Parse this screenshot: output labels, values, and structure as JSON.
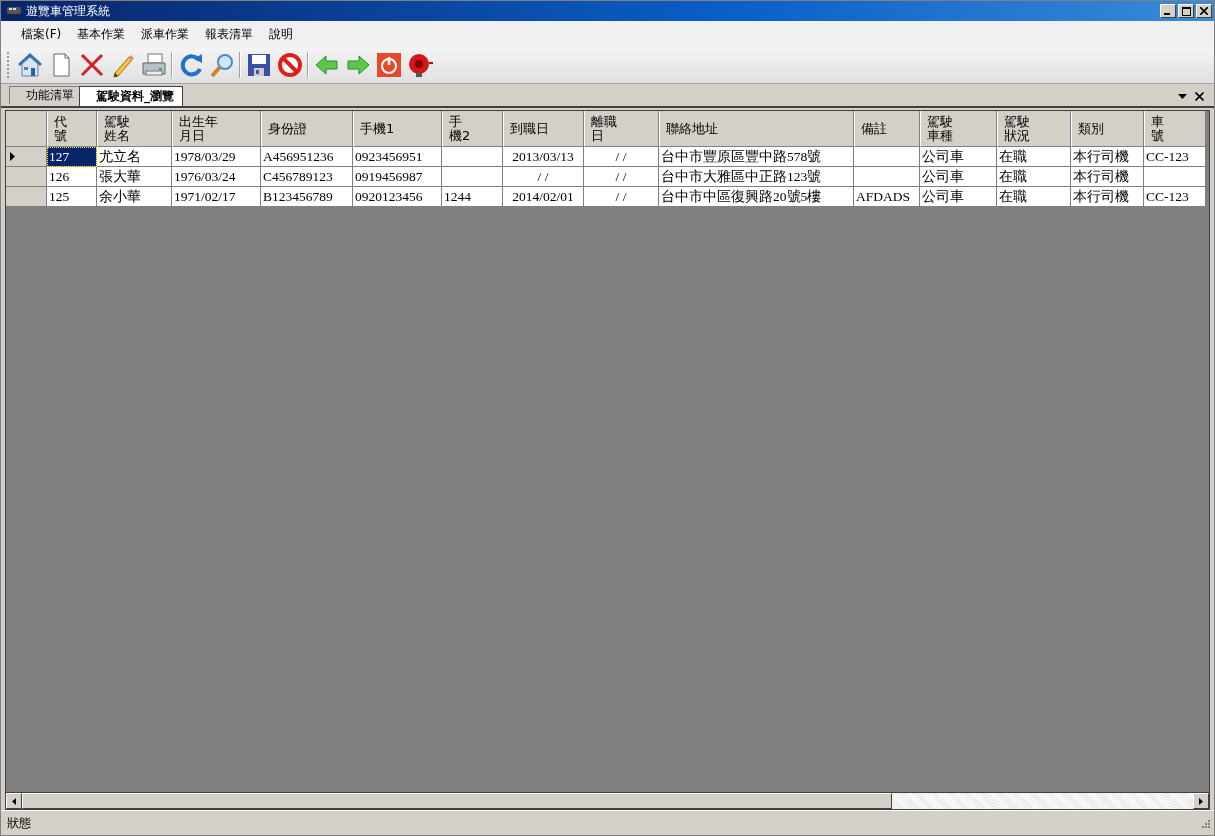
{
  "window": {
    "title": "遊覽車管理系統"
  },
  "menu": [
    {
      "label": "檔案(F)"
    },
    {
      "label": "基本作業"
    },
    {
      "label": "派車作業"
    },
    {
      "label": "報表清單"
    },
    {
      "label": "說明"
    }
  ],
  "toolbar": [
    {
      "kind": "home"
    },
    {
      "kind": "new"
    },
    {
      "kind": "delete"
    },
    {
      "kind": "edit"
    },
    {
      "kind": "print"
    },
    {
      "kind": "separator"
    },
    {
      "kind": "refresh"
    },
    {
      "kind": "search"
    },
    {
      "kind": "separator"
    },
    {
      "kind": "save"
    },
    {
      "kind": "cancel"
    },
    {
      "kind": "separator"
    },
    {
      "kind": "back"
    },
    {
      "kind": "forward"
    },
    {
      "kind": "power"
    },
    {
      "kind": "alarm"
    }
  ],
  "tabs": [
    {
      "label": "功能清單",
      "selected": false
    },
    {
      "label": "駕駛資料_瀏覽",
      "selected": true
    }
  ],
  "table": {
    "columns": [
      "代號",
      "駕駛姓名",
      "出生年月日",
      "身份證",
      "手機1",
      "手機2",
      "到職日",
      "離職日",
      "聯絡地址",
      "備註",
      "駕駛車種",
      "駕駛狀況",
      "類別",
      "車號"
    ],
    "rows": [
      {
        "selected": true,
        "cells": [
          "127",
          "尤立名",
          "1978/03/29",
          "A456951236",
          "0923456951",
          "",
          "2013/03/13",
          "/ /",
          "台中市豐原區豐中路578號",
          "",
          "公司車",
          "在職",
          "本行司機",
          "CC-123"
        ]
      },
      {
        "selected": false,
        "cells": [
          "126",
          "張大華",
          "1976/03/24",
          "C456789123",
          "0919456987",
          "",
          "/ /",
          "/ /",
          "台中市大雅區中正路123號",
          "",
          "公司車",
          "在職",
          "本行司機",
          ""
        ]
      },
      {
        "selected": false,
        "cells": [
          "125",
          "余小華",
          "1971/02/17",
          "B123456789",
          "0920123456",
          "1244",
          "2014/02/01",
          "/ /",
          "台中市中區復興路20號5樓",
          "AFDADS",
          "公司車",
          "在職",
          "本行司機",
          "CC-123"
        ]
      }
    ]
  },
  "status_bar": {
    "text": "狀態"
  }
}
